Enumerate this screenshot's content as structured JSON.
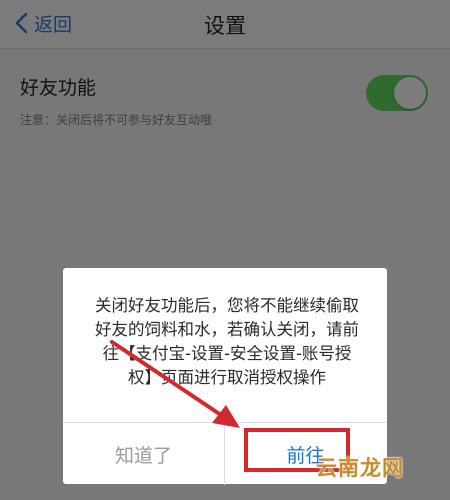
{
  "navbar": {
    "back_label": "返回",
    "title": "设置"
  },
  "setting": {
    "title": "好友功能",
    "description": "注意：关闭后将不可参与好友互动哦",
    "toggle_on": true
  },
  "dialog": {
    "message": "关闭好友功能后，您将不能继续偷取\n好友的饲料和水，若确认关闭，请前\n往【支付宝-设置-安全设置-账号授\n权】页面进行取消授权操作",
    "cancel_label": "知道了",
    "confirm_label": "前往"
  },
  "colors": {
    "confirm_blue": "#1b73d6",
    "annotation_red": "#d2292f",
    "toggle_green": "#2f6a2f"
  },
  "watermark": "云南龙网"
}
